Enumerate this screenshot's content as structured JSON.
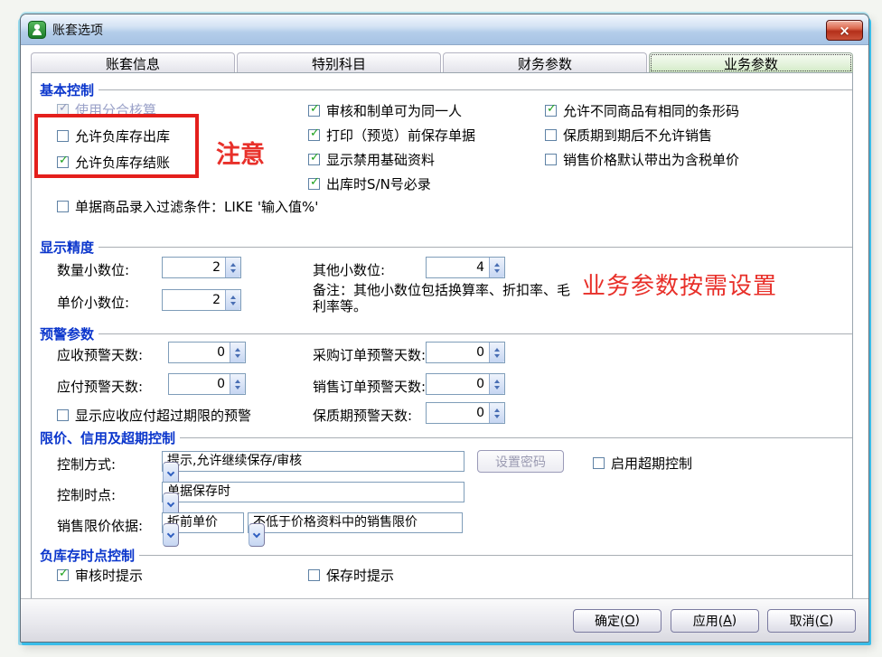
{
  "window": {
    "title": "账套选项",
    "close_glyph": "×"
  },
  "tabs": [
    {
      "label": "账套信息"
    },
    {
      "label": "特别科目"
    },
    {
      "label": "财务参数"
    },
    {
      "label": "业务参数"
    }
  ],
  "colors": {
    "accent_blue": "#0b36cc",
    "annotation_red": "#e8302a",
    "check_green": "#1da11d",
    "active_tab_green": "#cfe9c3"
  },
  "basic": {
    "title": "基本控制",
    "col1": [
      {
        "label": "使用分合核算",
        "check": "✓"
      },
      {
        "label": "允许负库存出库",
        "check": ""
      },
      {
        "label": "允许负库存结账",
        "check": "✓"
      }
    ],
    "col2": [
      {
        "label": "审核和制单可为同一人",
        "check": "✓"
      },
      {
        "label": "打印（预览）前保存单据",
        "check": "✓"
      },
      {
        "label": "显示禁用基础资料",
        "check": "✓"
      },
      {
        "label": "出库时S/N号必录",
        "check": "✓"
      }
    ],
    "col3": [
      {
        "label": "允许不同商品有相同的条形码",
        "check": "✓"
      },
      {
        "label": "保质期到期后不允许销售",
        "check": ""
      },
      {
        "label": "销售价格默认带出为含税单价",
        "check": ""
      }
    ],
    "filter": {
      "label": "单据商品录入过滤条件：LIKE '输入值%'",
      "check": ""
    }
  },
  "precision": {
    "title": "显示精度",
    "qty": {
      "label": "数量小数位:",
      "value": "2"
    },
    "other": {
      "label": "其他小数位:",
      "value": "4"
    },
    "price": {
      "label": "单价小数位:",
      "value": "2"
    },
    "note": "备注：其他小数位包括换算率、折扣率、毛利率等。"
  },
  "warning": {
    "title": "预警参数",
    "recv": {
      "label": "应收预警天数:",
      "value": "0"
    },
    "purchase": {
      "label": "采购订单预警天数:",
      "value": "0"
    },
    "pay": {
      "label": "应付预警天数:",
      "value": "0"
    },
    "sales": {
      "label": "销售订单预警天数:",
      "value": "0"
    },
    "overdue_check": {
      "label": "显示应收应付超过期限的预警",
      "check": ""
    },
    "shelf": {
      "label": "保质期预警天数:",
      "value": "0"
    }
  },
  "limit": {
    "title": "限价、信用及超期控制",
    "mode": {
      "label": "控制方式:",
      "value": "提示,允许继续保存/审核"
    },
    "password_button": "设置密码",
    "overdue": {
      "label": "启用超期控制",
      "check": ""
    },
    "time": {
      "label": "控制时点:",
      "value": "单据保存时"
    },
    "basis": {
      "label": "销售限价依据:",
      "value1": "折前单价",
      "value2": "不低于价格资料中的销售限价"
    }
  },
  "negative": {
    "title": "负库存时点控制",
    "audit": {
      "label": "审核时提示",
      "check": "✓"
    },
    "save": {
      "label": "保存时提示",
      "check": ""
    }
  },
  "annotations": {
    "notice": "注意",
    "hint": "业务参数按需设置"
  },
  "footer": {
    "ok": {
      "pre": "确定(",
      "key": "O",
      "post": ")"
    },
    "apply": {
      "pre": "应用(",
      "key": "A",
      "post": ")"
    },
    "cancel": {
      "pre": "取消(",
      "key": "C",
      "post": ")"
    }
  }
}
